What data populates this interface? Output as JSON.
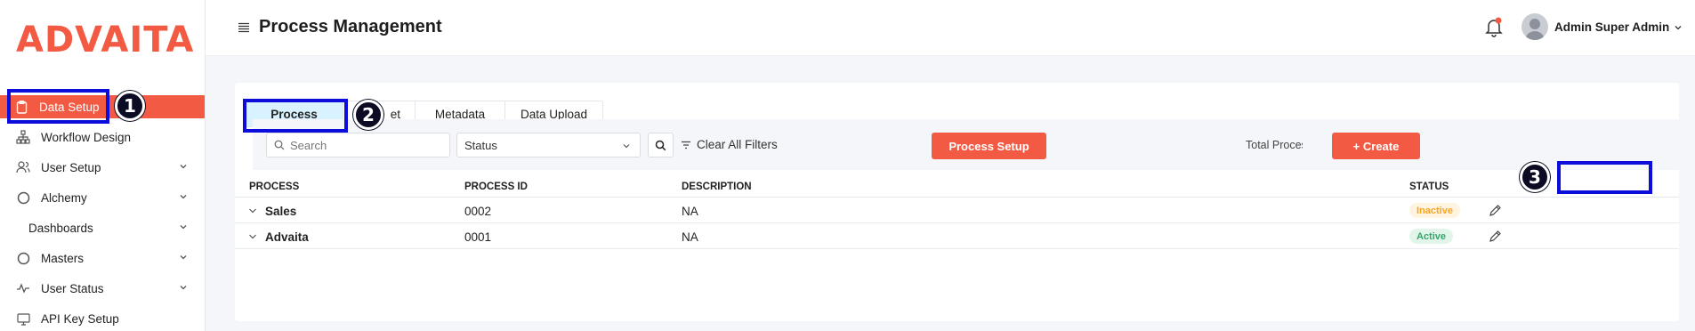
{
  "app": {
    "logo": "ADVAITA"
  },
  "sidebar": {
    "items": [
      {
        "label": "Data Setup",
        "icon": "clipboard-icon",
        "active": true,
        "has_chevron": false
      },
      {
        "label": "Workflow Design",
        "icon": "hierarchy-icon",
        "active": false,
        "has_chevron": false
      },
      {
        "label": "User Setup",
        "icon": "users-icon",
        "active": false,
        "has_chevron": true
      },
      {
        "label": "Alchemy",
        "icon": "circle-icon",
        "active": false,
        "has_chevron": true
      },
      {
        "label": "Dashboards",
        "icon": "",
        "active": false,
        "has_chevron": true
      },
      {
        "label": "Masters",
        "icon": "circle-icon",
        "active": false,
        "has_chevron": true
      },
      {
        "label": "User Status",
        "icon": "activity-icon",
        "active": false,
        "has_chevron": true
      },
      {
        "label": "API Key Setup",
        "icon": "monitor-icon",
        "active": false,
        "has_chevron": false
      }
    ]
  },
  "header": {
    "title": "Process Management",
    "user_name": "Admin Super Admin"
  },
  "tabs": [
    {
      "label": "Process",
      "active": true
    },
    {
      "label": "et",
      "active": false
    },
    {
      "label": "Metadata",
      "active": false
    },
    {
      "label": "Data Upload",
      "active": false
    }
  ],
  "filters": {
    "search_placeholder": "Search",
    "status_value": "Status",
    "clear_label": "Clear All Filters",
    "process_setup_label": "Process Setup",
    "total_label": "Total Process",
    "create_label": "+ Create"
  },
  "table": {
    "columns": [
      "PROCESS",
      "PROCESS ID",
      "DESCRIPTION",
      "STATUS"
    ],
    "rows": [
      {
        "process": "Sales",
        "process_id": "0002",
        "description": "NA",
        "status": "Inactive"
      },
      {
        "process": "Advaita",
        "process_id": "0001",
        "description": "NA",
        "status": "Active"
      }
    ]
  },
  "annotations": [
    "1",
    "2",
    "3"
  ],
  "colors": {
    "brand": "#f25a43",
    "active_tab": "#d8f3ff",
    "highlight": "#0d0ddb",
    "inactive_badge": "#f5a524",
    "active_badge": "#35a76a"
  }
}
